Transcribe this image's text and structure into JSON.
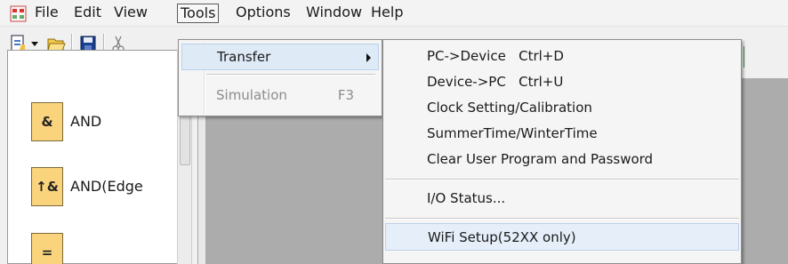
{
  "menubar": {
    "items": [
      {
        "label": "File"
      },
      {
        "label": "Edit"
      },
      {
        "label": "View"
      },
      {
        "label": "Tools"
      },
      {
        "label": "Options"
      },
      {
        "label": "Window"
      },
      {
        "label": "Help"
      }
    ],
    "active": "Tools"
  },
  "toolbar": {
    "icons": [
      "new-document-icon",
      "dropdown-arrow-icon",
      "open-folder-icon",
      "save-icon",
      "cut-icon"
    ]
  },
  "palette": {
    "items": [
      {
        "icon": "&",
        "label": "AND"
      },
      {
        "icon": "↑&",
        "label": "AND(Edge"
      },
      {
        "icon": "=",
        "label": ""
      }
    ]
  },
  "tools_menu": {
    "items": [
      {
        "label": "Transfer",
        "shortcut": "",
        "has_submenu": true,
        "enabled": true
      },
      {
        "label": "Simulation",
        "shortcut": "F3",
        "has_submenu": false,
        "enabled": false
      }
    ]
  },
  "transfer_submenu": {
    "items": [
      {
        "label": "PC->Device   Ctrl+D"
      },
      {
        "label": "Device->PC   Ctrl+U"
      },
      {
        "label": "Clock Setting/Calibration"
      },
      {
        "label": "SummerTime/WinterTime"
      },
      {
        "label": "Clear User Program and Password"
      },
      {
        "label": "I/O Status..."
      },
      {
        "label": "WiFi Setup(52XX only)"
      }
    ],
    "hovered": "WiFi Setup(52XX only)"
  },
  "colors": {
    "menu_bg": "#f5f5f5",
    "highlight": "#e5eef9",
    "workspace": "#acacac",
    "palette_icon": "#fad47c"
  }
}
